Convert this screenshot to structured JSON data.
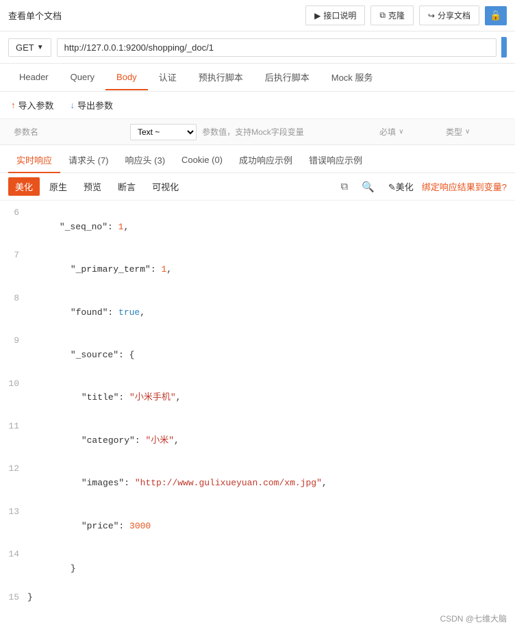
{
  "topbar": {
    "title": "查看单个文档",
    "btn_api_doc": "接口说明",
    "btn_clone": "克隆",
    "btn_share": "分享文档"
  },
  "urlbar": {
    "method": "GET",
    "url": "http://127.0.0.1:9200/shopping/_doc/1"
  },
  "tabs": [
    {
      "label": "Header",
      "active": false
    },
    {
      "label": "Query",
      "active": false
    },
    {
      "label": "Body",
      "active": true
    },
    {
      "label": "认证",
      "active": false
    },
    {
      "label": "预执行脚本",
      "active": false
    },
    {
      "label": "后执行脚本",
      "active": false
    },
    {
      "label": "Mock 服务",
      "active": false
    }
  ],
  "params": {
    "import_label": "导入参数",
    "export_label": "导出参数"
  },
  "body_table": {
    "col_name": "参数名",
    "col_type_label": "Text ~",
    "col_value": "参数值，支持Mock字段变量",
    "col_required": "必填",
    "col_type": "类型"
  },
  "response_tabs": [
    {
      "label": "实时响应",
      "active": true
    },
    {
      "label": "请求头 (7)",
      "active": false
    },
    {
      "label": "响应头 (3)",
      "active": false
    },
    {
      "label": "Cookie (0)",
      "active": false
    },
    {
      "label": "成功响应示例",
      "active": false
    },
    {
      "label": "错误响应示例",
      "active": false
    }
  ],
  "resp_toolbar": {
    "beautify": "美化",
    "raw": "原生",
    "preview": "预览",
    "assert": "断言",
    "visualize": "可视化",
    "beautify_icon": "✎美化",
    "bind_label": "绑定响应结果到变量?"
  },
  "code_lines": [
    {
      "num": "6",
      "content": "\"_seq_no\": 1,",
      "type": "key_num"
    },
    {
      "num": "7",
      "content": "\"_primary_term\": 1,",
      "type": "key_num"
    },
    {
      "num": "8",
      "content": "\"found\": true,",
      "type": "key_bool"
    },
    {
      "num": "9",
      "content": "\"_source\": {",
      "type": "plain"
    },
    {
      "num": "10",
      "content": "\"title\": \"小米手机\",",
      "type": "key_str"
    },
    {
      "num": "11",
      "content": "\"category\": \"小米\",",
      "type": "key_str"
    },
    {
      "num": "12",
      "content": "\"images\": \"http://www.gulixueyuan.com/xm.jpg\",",
      "type": "key_str"
    },
    {
      "num": "13",
      "content": "\"price\": 3000",
      "type": "key_num_val"
    },
    {
      "num": "14",
      "content": "}",
      "type": "plain"
    },
    {
      "num": "15",
      "content": "}",
      "type": "plain"
    }
  ],
  "footer": {
    "text": "CSDN @七维大脑"
  }
}
